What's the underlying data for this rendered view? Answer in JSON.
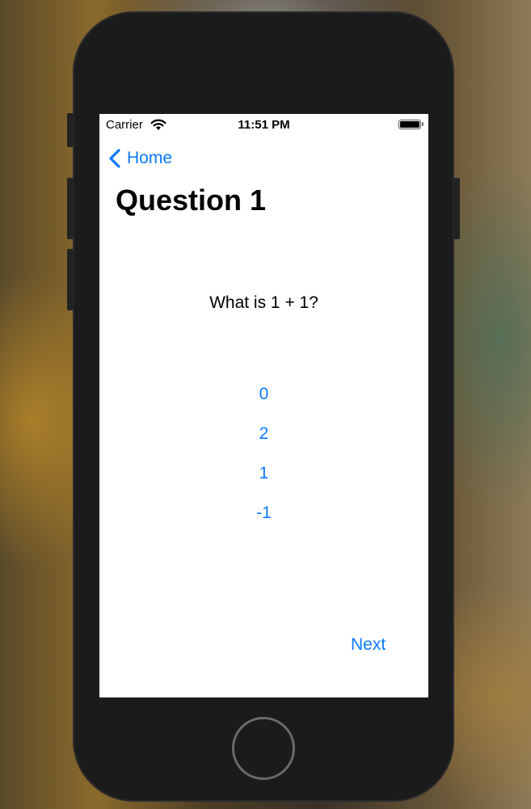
{
  "status_bar": {
    "carrier": "Carrier",
    "time": "11:51 PM",
    "wifi_icon": "wifi-icon",
    "battery_icon": "battery-full-icon"
  },
  "nav": {
    "back_label": "Home",
    "back_icon": "chevron-left-icon"
  },
  "page": {
    "title": "Question 1",
    "question": "What is 1 + 1?",
    "answers": [
      "0",
      "2",
      "1",
      "-1"
    ],
    "next_label": "Next"
  },
  "colors": {
    "accent": "#0a7aff",
    "text": "#000000",
    "screen_bg": "#ffffff",
    "device_bezel": "#1b1b1b"
  }
}
